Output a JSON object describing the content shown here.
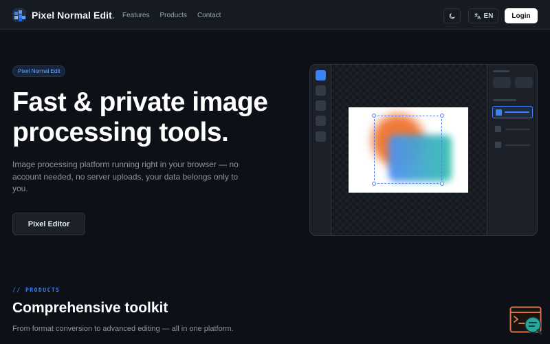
{
  "nav": {
    "brand_name": "Pixel Normal Edit",
    "brand_dot": ".",
    "links": [
      "Features",
      "Products",
      "Contact"
    ],
    "lang_label": "EN",
    "login_label": "Login"
  },
  "hero": {
    "badge": "Pixel Normal Edit",
    "title": "Fast & private image processing tools.",
    "description": "Image processing platform running right in your browser — no account needed, no server uploads, your data belongs only to you.",
    "cta_label": "Pixel Editor"
  },
  "products": {
    "eyebrow": "// PRODUCTS",
    "title": "Comprehensive toolkit",
    "subtitle": "From format conversion to advanced editing — all in one platform."
  },
  "icons": {
    "brand": "pixel-logo-icon",
    "theme": "moon-icon",
    "language": "translate-icon",
    "assistant": "chat-assistant-icon"
  },
  "colors": {
    "background": "#0d1117",
    "accent": "#3b82f6",
    "art_orange": "#ee7a3a",
    "art_teal": "#36c0ad"
  }
}
